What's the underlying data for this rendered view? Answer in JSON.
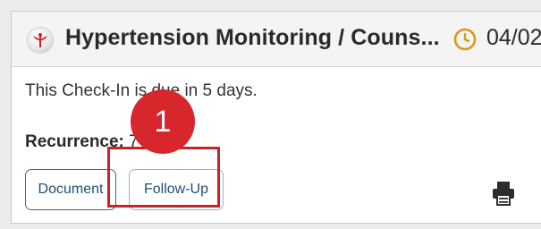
{
  "header": {
    "title": "Hypertension Monitoring / Couns...",
    "date": "04/02",
    "icon": "caduceus-icon",
    "clock_icon": "clock-icon",
    "accent_color": "#d89a1a"
  },
  "body": {
    "due_text": "This Check-In is due in 5 days.",
    "recurrence_label": "Recurrence:",
    "recurrence_value": "7 days"
  },
  "actions": {
    "document_label": "Document",
    "followup_label": "Follow-Up",
    "print_icon": "print-icon",
    "button_color": "#1e4f74"
  },
  "annotation": {
    "step_number": "1",
    "highlight_color": "#c8232a"
  }
}
